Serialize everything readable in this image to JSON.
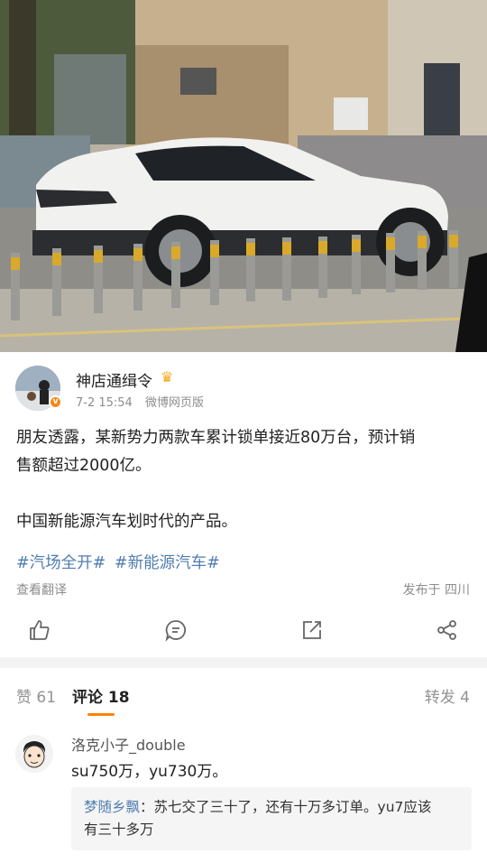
{
  "post": {
    "username": "神店通缉令",
    "date": "7-2 15:54",
    "source": "微博网页版",
    "content_line1": "朋友透露，某新势力两款车累计锁单接近80万台，预计销",
    "content_line2": "售额超过2000亿。",
    "content_line3": "中国新能源汽车划时代的产品。",
    "tags": [
      "#汽场全开#",
      "#新能源汽车#"
    ],
    "translate_label": "查看翻译",
    "location": "发布于 四川"
  },
  "actions": {
    "icons": [
      "thumbs-up-icon",
      "comment-icon",
      "share-forward-icon",
      "share-network-icon"
    ]
  },
  "tabs": {
    "likes": "赞 61",
    "comments": "评论 18",
    "reposts": "转发 4"
  },
  "comment": {
    "name": "洛克小子_double",
    "text": "su750万，yu730万。",
    "reply_name": "梦随乡飘",
    "reply_text_line1": "：苏七交了三十了，还有十万多订单。yu7应该",
    "reply_text_line2": "有三十多万"
  },
  "colors": {
    "link": "#507daf",
    "accent": "#ff8200",
    "meta": "#8d8d8d"
  }
}
